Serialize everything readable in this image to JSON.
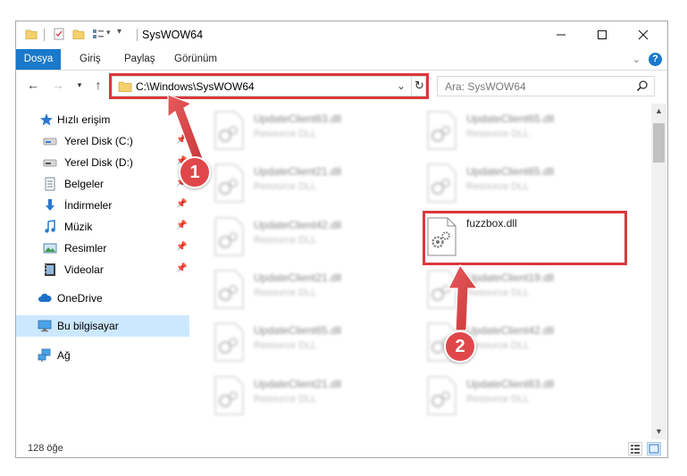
{
  "window": {
    "title": "SysWOW64"
  },
  "ribbon": {
    "tabs": [
      "Dosya",
      "Giriş",
      "Paylaş",
      "Görünüm"
    ]
  },
  "address": {
    "path": "C:\\Windows\\SysWOW64"
  },
  "search": {
    "placeholder": "Ara: SysWOW64"
  },
  "navigation": {
    "items": [
      {
        "label": "Hızlı erişim",
        "icon": "star-icon",
        "pinned": false
      },
      {
        "label": "Yerel Disk (C:)",
        "icon": "drive-icon",
        "pinned": true
      },
      {
        "label": "Yerel Disk (D:)",
        "icon": "drive-icon",
        "pinned": true
      },
      {
        "label": "Belgeler",
        "icon": "documents-icon",
        "pinned": true
      },
      {
        "label": "İndirmeler",
        "icon": "download-icon",
        "pinned": true
      },
      {
        "label": "Müzik",
        "icon": "music-icon",
        "pinned": true
      },
      {
        "label": "Resimler",
        "icon": "pictures-icon",
        "pinned": true
      },
      {
        "label": "Videolar",
        "icon": "videos-icon",
        "pinned": true
      },
      {
        "label": "OneDrive",
        "icon": "cloud-icon",
        "pinned": false
      },
      {
        "label": "Bu bilgisayar",
        "icon": "computer-icon",
        "pinned": false,
        "selected": true
      },
      {
        "label": "Ağ",
        "icon": "network-icon",
        "pinned": false
      }
    ]
  },
  "files": [
    {
      "name": "UpdateClient63.dll",
      "type": "Resource DLL"
    },
    {
      "name": "UpdateClient65.dll",
      "type": "Resource DLL"
    },
    {
      "name": "UpdateClient21.dll",
      "type": "Resource DLL"
    },
    {
      "name": "UpdateClient65.dll",
      "type": "Resource DLL"
    },
    {
      "name": "UpdateClient42.dll",
      "type": "Resource DLL"
    },
    {
      "name": "fuzzbox.dll",
      "type": ""
    },
    {
      "name": "UpdateClient21.dll",
      "type": "Resource DLL"
    },
    {
      "name": "UpdateClient19.dll",
      "type": "Resource DLL"
    },
    {
      "name": "UpdateClient65.dll",
      "type": "Resource DLL"
    },
    {
      "name": "UpdateClient42.dll",
      "type": "Resource DLL"
    },
    {
      "name": "UpdateClient21.dll",
      "type": "Resource DLL"
    },
    {
      "name": "UpdateClient63.dll",
      "type": "Resource DLL"
    }
  ],
  "status": {
    "item_count": "128 öğe"
  },
  "annotations": {
    "step1": "1",
    "step2": "2"
  },
  "colors": {
    "accent": "#1979ca",
    "highlight": "#d9393c",
    "badge": "#e0474a",
    "selected_bg": "#cce8ff"
  }
}
